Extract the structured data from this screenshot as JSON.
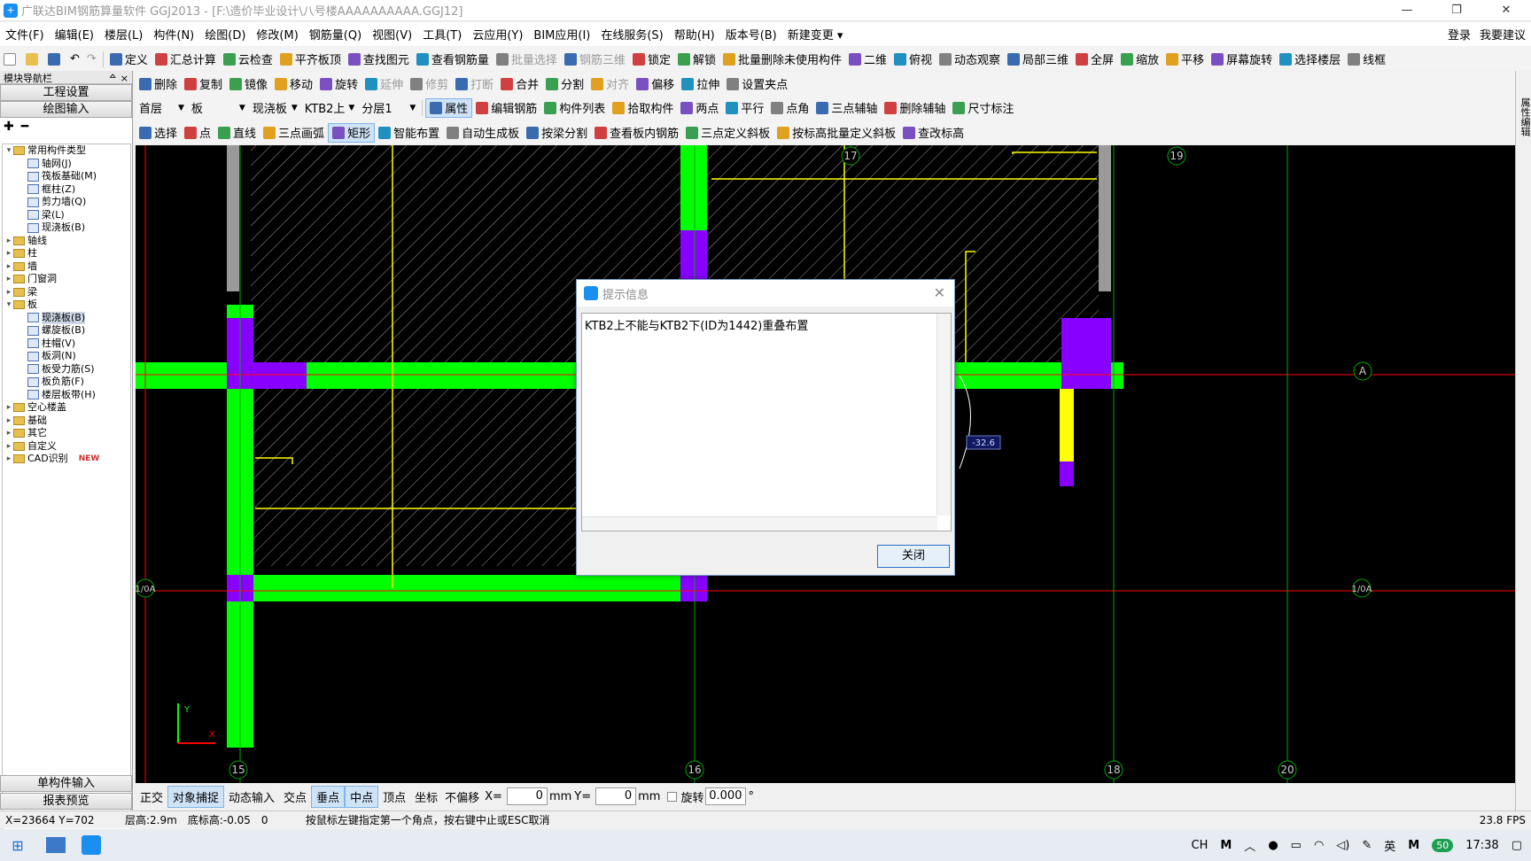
{
  "window": {
    "title": "广联达BIM钢筋算量软件 GGJ2013 - [F:\\造价毕业设计\\八号楼AAAAAAAAAA.GGJ12]",
    "min": "—",
    "restore": "❐",
    "close": "✕"
  },
  "menu": {
    "items": [
      "文件(F)",
      "编辑(E)",
      "楼层(L)",
      "构件(N)",
      "绘图(D)",
      "修改(M)",
      "钢筋量(Q)",
      "视图(V)",
      "工具(T)",
      "云应用(Y)",
      "BIM应用(I)",
      "在线服务(S)",
      "帮助(H)",
      "版本号(B)",
      "新建变更 ▾"
    ],
    "login": "登录",
    "suggest": "我要建议"
  },
  "toolbar1": [
    "定义",
    "汇总计算",
    "云检查",
    "平齐板顶",
    "查找图元",
    "查看钢筋量",
    "批量选择",
    "钢筋三维",
    "锁定",
    "解锁",
    "批量删除未使用构件",
    "二维",
    "俯视",
    "动态观察",
    "局部三维",
    "全屏",
    "缩放",
    "平移",
    "屏幕旋转",
    "选择楼层",
    "线框"
  ],
  "toolbar2": [
    "删除",
    "复制",
    "镜像",
    "移动",
    "旋转",
    "延伸",
    "修剪",
    "打断",
    "合并",
    "分割",
    "对齐",
    "偏移",
    "拉伸",
    "设置夹点"
  ],
  "toolbar3": {
    "floor": "首层",
    "category": "板",
    "type": "现浇板",
    "component": "KTB2上",
    "layer": "分层1",
    "buttons": [
      "属性",
      "编辑钢筋",
      "构件列表",
      "拾取构件",
      "两点",
      "平行",
      "点角",
      "三点辅轴",
      "删除辅轴",
      "尺寸标注"
    ]
  },
  "toolbar4": [
    "选择",
    "点",
    "直线",
    "三点画弧",
    "矩形",
    "智能布置",
    "自动生成板",
    "按梁分割",
    "查看板内钢筋",
    "三点定义斜板",
    "按标高批量定义斜板",
    "查改标高"
  ],
  "leftpanel": {
    "header": "模块导航栏",
    "pin": "ᅀ ×",
    "btn_project": "工程设置",
    "btn_draw": "绘图输入",
    "btn_single": "单构件输入",
    "btn_report": "报表预览",
    "tree": [
      {
        "label": "常用构件类型",
        "level": 0,
        "folder": true,
        "open": true
      },
      {
        "label": "轴网(J)",
        "level": 1
      },
      {
        "label": "筏板基础(M)",
        "level": 1
      },
      {
        "label": "框柱(Z)",
        "level": 1
      },
      {
        "label": "剪力墙(Q)",
        "level": 1
      },
      {
        "label": "梁(L)",
        "level": 1
      },
      {
        "label": "现浇板(B)",
        "level": 1
      },
      {
        "label": "轴线",
        "level": 0,
        "folder": true
      },
      {
        "label": "柱",
        "level": 0,
        "folder": true
      },
      {
        "label": "墙",
        "level": 0,
        "folder": true
      },
      {
        "label": "门窗洞",
        "level": 0,
        "folder": true
      },
      {
        "label": "梁",
        "level": 0,
        "folder": true
      },
      {
        "label": "板",
        "level": 0,
        "folder": true,
        "open": true
      },
      {
        "label": "现浇板(B)",
        "level": 1,
        "selected": true
      },
      {
        "label": "螺旋板(B)",
        "level": 1
      },
      {
        "label": "柱帽(V)",
        "level": 1
      },
      {
        "label": "板洞(N)",
        "level": 1
      },
      {
        "label": "板受力筋(S)",
        "level": 1
      },
      {
        "label": "板负筋(F)",
        "level": 1
      },
      {
        "label": "楼层板带(H)",
        "level": 1
      },
      {
        "label": "空心楼盖",
        "level": 0,
        "folder": true
      },
      {
        "label": "基础",
        "level": 0,
        "folder": true
      },
      {
        "label": "其它",
        "level": 0,
        "folder": true
      },
      {
        "label": "自定义",
        "level": 0,
        "folder": true
      },
      {
        "label": "CAD识别",
        "level": 0,
        "folder": true,
        "badge": "NEW"
      }
    ]
  },
  "canvas": {
    "axis_labels": [
      "17",
      "19",
      "A",
      "1/0A",
      "1/0A",
      "15",
      "16",
      "18",
      "20"
    ],
    "dim_value": "-32.6"
  },
  "snapbar": {
    "items": [
      "正交",
      "对象捕捉",
      "动态输入",
      "交点",
      "垂点",
      "中点",
      "顶点",
      "坐标"
    ],
    "offset": "不偏移",
    "x_label": "X=",
    "x_val": "0",
    "mm1": "mm",
    "y_label": "Y=",
    "y_val": "0",
    "mm2": "mm",
    "rotate": "旋转",
    "rot_val": "0.000",
    "deg": "°"
  },
  "status": {
    "coords": "X=23664 Y=702",
    "floor_h": "层高:2.9m",
    "base_h": "底标高:-0.05",
    "zero": "0",
    "hint": "按鼠标左键指定第一个角点，按右键中止或ESC取消",
    "fps": "23.8 FPS"
  },
  "dialog": {
    "title": "提示信息",
    "message": "KTB2上不能与KTB2下(ID为1442)重叠布置",
    "close_btn": "关闭"
  },
  "taskbar": {
    "lang": "CH",
    "ime": "英",
    "time": "17:38",
    "badge": "50"
  },
  "right_strip": "属性编辑"
}
